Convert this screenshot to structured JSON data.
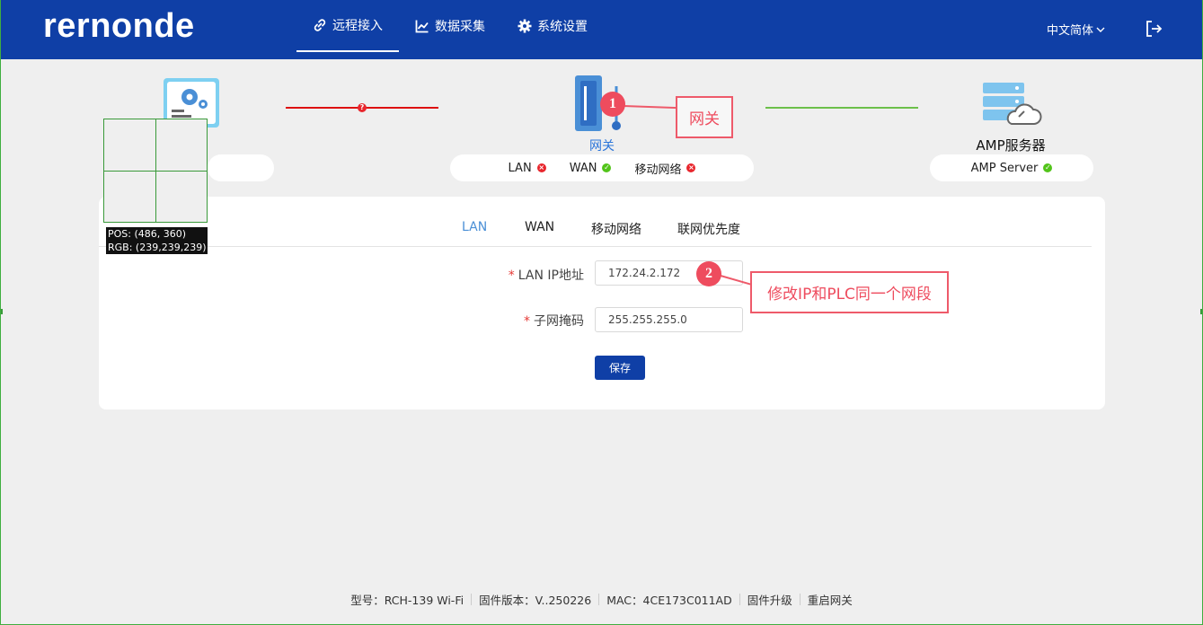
{
  "header": {
    "logo_text": "rernonde",
    "nav": [
      {
        "label": "远程接入",
        "icon": "link-icon",
        "active": true
      },
      {
        "label": "数据采集",
        "icon": "chart-icon",
        "active": false
      },
      {
        "label": "系统设置",
        "icon": "gear-icon",
        "active": false
      }
    ],
    "language": "中文简体",
    "colors": {
      "brand": "#0f3fa6",
      "accent": "#4a8fd6",
      "error": "#e8262d",
      "ok": "#52c41a",
      "annotation": "#ee4c5e"
    }
  },
  "topology": {
    "gateway_label": "网关",
    "gateway_status": [
      {
        "label": "LAN",
        "status": "error"
      },
      {
        "label": "WAN",
        "status": "ok"
      },
      {
        "label": "移动网络",
        "status": "error"
      }
    ],
    "server_title": "AMP服务器",
    "server_status": {
      "label": "AMP Server",
      "status": "ok"
    }
  },
  "tabs": [
    {
      "label": "LAN",
      "active": true
    },
    {
      "label": "WAN",
      "active": false
    },
    {
      "label": "移动网络",
      "active": false
    },
    {
      "label": "联网优先度",
      "active": false
    }
  ],
  "form": {
    "ip_label": "LAN IP地址",
    "ip_value": "172.24.2.172",
    "mask_label": "子网掩码",
    "mask_value": "255.255.255.0",
    "required_mark": "*",
    "save_label": "保存"
  },
  "annotations": {
    "badge1": "1",
    "callout1": "网关",
    "badge2": "2",
    "callout2": "修改IP和PLC同一个网段"
  },
  "magnifier": {
    "pos": "POS: (486, 360)",
    "rgb": "RGB: (239,239,239)"
  },
  "footer": {
    "model": "型号：RCH-139  Wi-Fi",
    "firmware": "固件版本：V..250226",
    "mac": "MAC：4CE173C011AD",
    "upgrade": "固件升级",
    "reboot": "重启网关"
  }
}
